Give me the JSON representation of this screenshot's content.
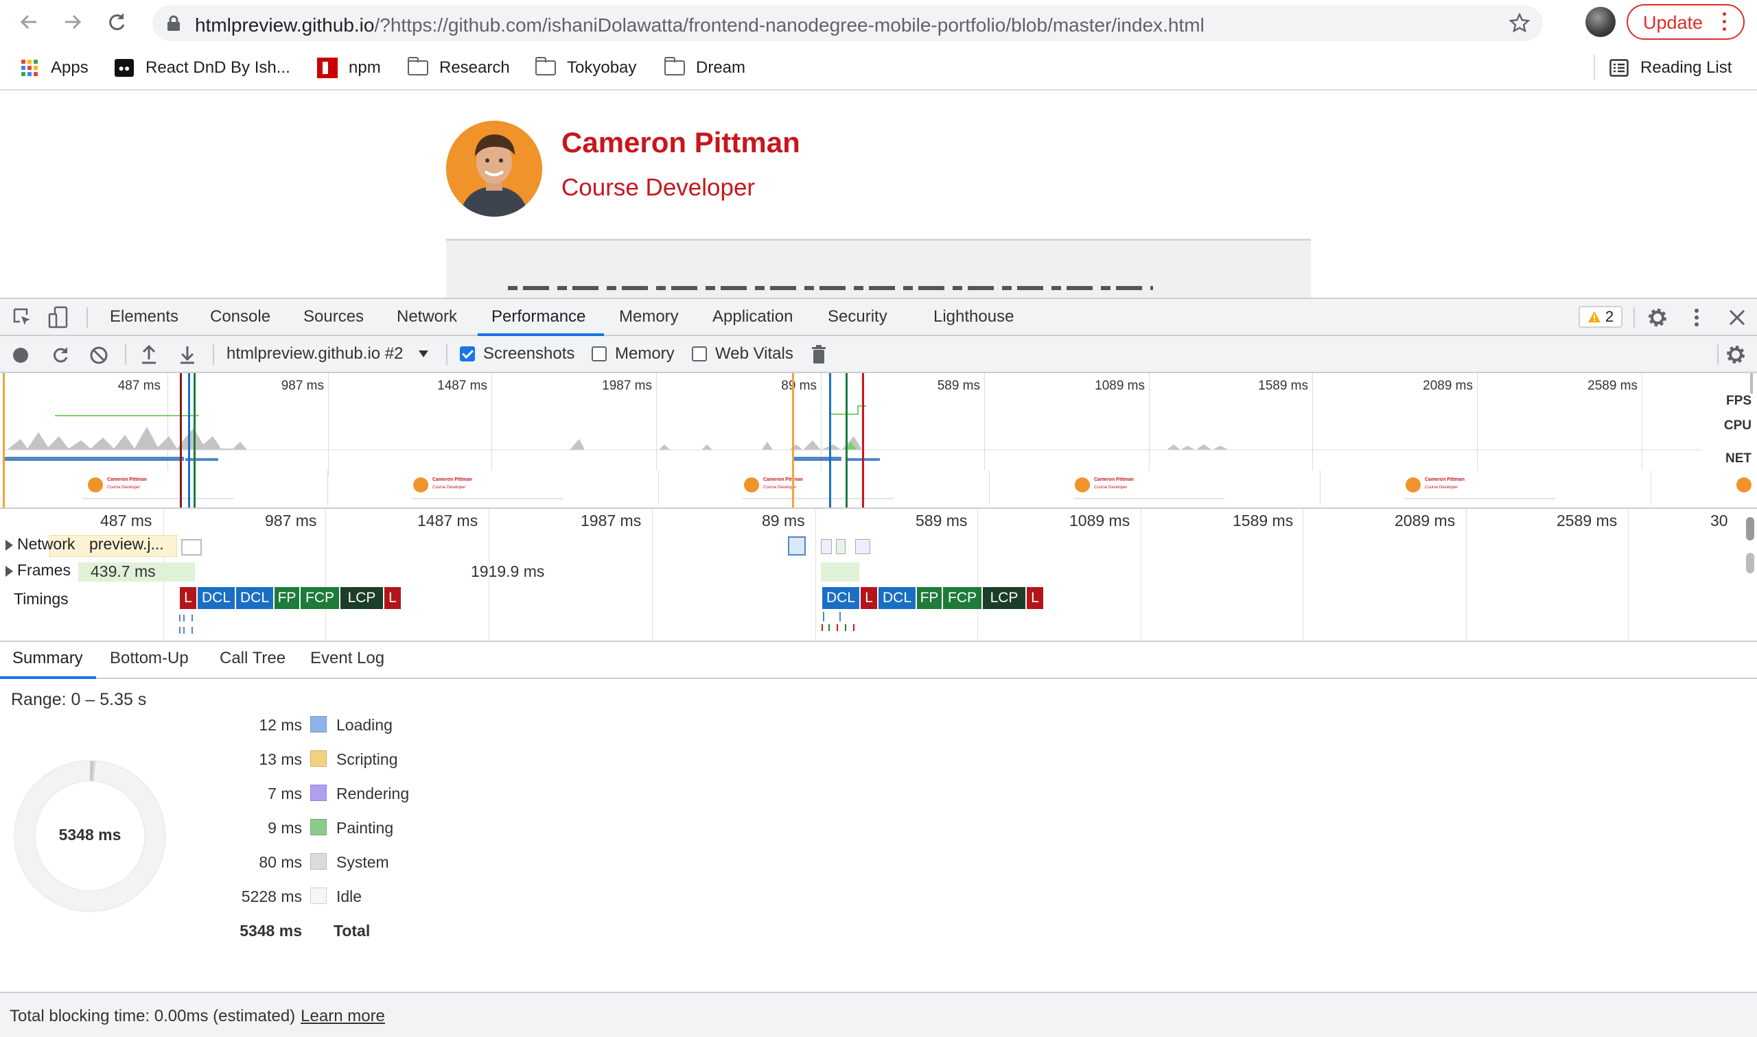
{
  "browser": {
    "url_host": "htmlpreview.github.io",
    "url_rest": "/?https://github.com/ishaniDolawatta/frontend-nanodegree-mobile-portfolio/blob/master/index.html",
    "update_label": "Update",
    "bookmarks": [
      "Apps",
      "React DnD By Ish...",
      "npm",
      "Research",
      "Tokyobay",
      "Dream"
    ],
    "reading_list": "Reading List"
  },
  "page": {
    "name": "Cameron Pittman",
    "role": "Course Developer"
  },
  "devtools": {
    "tabs": [
      "Elements",
      "Console",
      "Sources",
      "Network",
      "Performance",
      "Memory",
      "Application",
      "Security",
      "Lighthouse"
    ],
    "active_tab": "Performance",
    "warning_count": "2",
    "recording_target": "htmlpreview.github.io #2",
    "checkboxes": {
      "screenshots": {
        "label": "Screenshots",
        "checked": true
      },
      "memory": {
        "label": "Memory",
        "checked": false
      },
      "web_vitals": {
        "label": "Web Vitals",
        "checked": false
      }
    },
    "overview": {
      "tick_labels": [
        "487 ms",
        "987 ms",
        "1487 ms",
        "1987 ms",
        "89 ms",
        "589 ms",
        "1089 ms",
        "1589 ms",
        "2089 ms",
        "2589 ms"
      ],
      "side_labels": [
        "FPS",
        "CPU",
        "NET"
      ],
      "screenshot_title": "Cameron Pittman",
      "screenshot_subtitle": "Course Developer"
    },
    "flame": {
      "tick_labels": [
        "487 ms",
        "987 ms",
        "1487 ms",
        "1987 ms",
        "89 ms",
        "589 ms",
        "1089 ms",
        "1589 ms",
        "2089 ms",
        "2589 ms",
        "30"
      ],
      "network_label": "Network",
      "network_item": "preview.j...",
      "frames_label": "Frames",
      "frame_1": "439.7 ms",
      "frame_2": "1919.9 ms",
      "timings_label": "Timings",
      "timings_group_1": [
        "L",
        "DCL",
        "DCL",
        "FP",
        "FCP",
        "LCP",
        "L"
      ],
      "timings_group_2": [
        "DCL",
        "L",
        "DCL",
        "FP",
        "FCP",
        "LCP",
        "L"
      ]
    },
    "bottom_tabs": [
      "Summary",
      "Bottom-Up",
      "Call Tree",
      "Event Log"
    ],
    "summary": {
      "range": "Range: 0 – 5.35 s",
      "total_center": "5348 ms",
      "rows": [
        {
          "value": "12 ms",
          "name": "Loading",
          "color": "#8cb4ea"
        },
        {
          "value": "13 ms",
          "name": "Scripting",
          "color": "#f3d27f"
        },
        {
          "value": "7 ms",
          "name": "Rendering",
          "color": "#b09ef0"
        },
        {
          "value": "9 ms",
          "name": "Painting",
          "color": "#8ec98c"
        },
        {
          "value": "80 ms",
          "name": "System",
          "color": "#dcdcdc"
        },
        {
          "value": "5228 ms",
          "name": "Idle",
          "color": "#f6f6f6"
        }
      ],
      "total_value": "5348 ms",
      "total_label": "Total"
    },
    "footer": {
      "text": "Total blocking time: 0.00ms (estimated)",
      "link": "Learn more"
    }
  }
}
